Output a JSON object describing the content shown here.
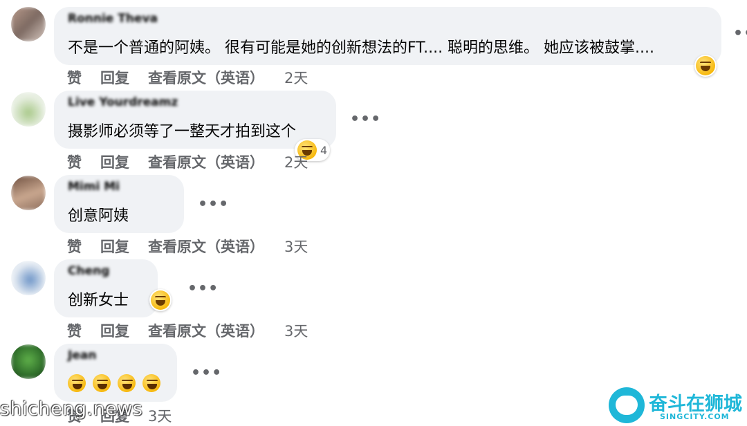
{
  "comments": [
    {
      "author": "Ronnie Theva",
      "text": "不是一个普通的阿姨。 很有可能是她的创新想法的FT.... 聪明的思维。 她应该被鼓掌....",
      "like": "赞",
      "reply": "回复",
      "translate": "查看原文（英语）",
      "time": "2天",
      "reaction_count": ""
    },
    {
      "author": "Live Yourdreamz",
      "text": "摄影师必须等了一整天才拍到这个",
      "like": "赞",
      "reply": "回复",
      "translate": "查看原文（英语）",
      "time": "2天",
      "reaction_count": "4"
    },
    {
      "author": "Mimi Mi",
      "text": "创意阿姨",
      "like": "赞",
      "reply": "回复",
      "translate": "查看原文（英语）",
      "time": "3天"
    },
    {
      "author": "Cheng",
      "text": "创新女士",
      "like": "赞",
      "reply": "回复",
      "translate": "查看原文（英语）",
      "time": "3天"
    },
    {
      "author": "Jean",
      "text": "",
      "like": "赞",
      "reply": "回复",
      "time": "3天"
    }
  ],
  "more_label": "•••",
  "watermarks": {
    "left": "shicheng.news",
    "logo_text": "奋斗在狮城",
    "logo_sub": "SINGCITY.COM"
  },
  "colors": {
    "bubble": "#f0f2f5",
    "action_text": "#65676b",
    "logo": "#1fb7d8"
  },
  "icons": [
    "laughing-emoji-icon",
    "more-options-icon",
    "rolling-laughing-emoji-icon"
  ]
}
